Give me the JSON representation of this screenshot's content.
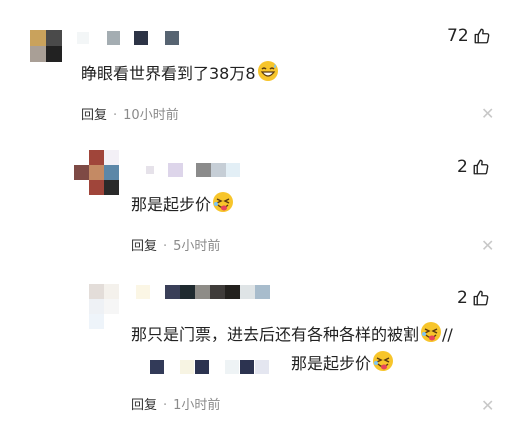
{
  "comments": [
    {
      "text": "睁眼看世界看到了38万8",
      "emoji": "grinning-sweat-face-icon",
      "reply_label": "回复",
      "separator": "·",
      "time": "10小时前",
      "likes": "72"
    },
    {
      "text": "那是起步价",
      "emoji": "laughing-tongue-face-icon",
      "reply_label": "回复",
      "separator": "·",
      "time": "5小时前",
      "likes": "2"
    },
    {
      "text_line1": "那只是门票，进去后还有各种各样的被割",
      "slashes": "//",
      "text_line2": "那是起步价",
      "emoji": "laughing-tongue-face-icon",
      "reply_label": "回复",
      "separator": "·",
      "time": "1小时前",
      "likes": "2"
    }
  ],
  "colors": {
    "text": "#222222",
    "meta": "#8a8a8a",
    "close": "#c8c8c8",
    "emoji_yellow": "#f7c52b"
  }
}
